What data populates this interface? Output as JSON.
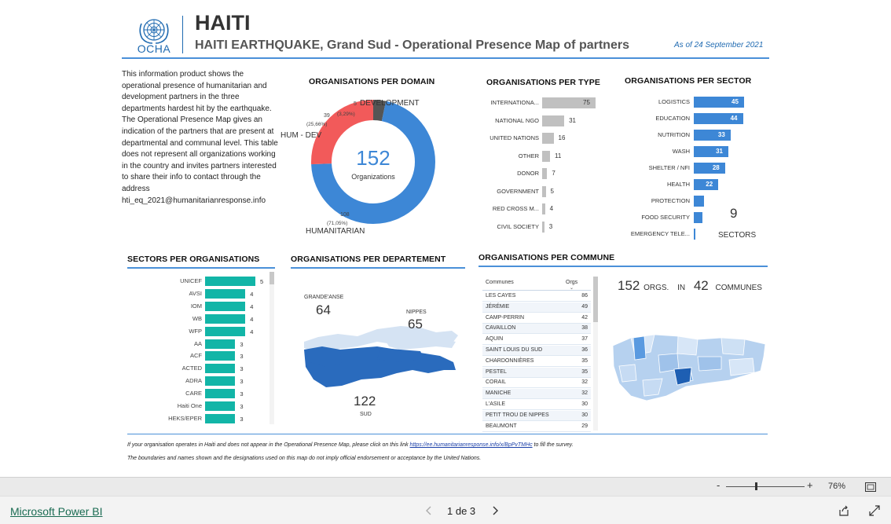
{
  "header": {
    "org_name": "OCHA",
    "title": "HAITI",
    "subtitle": "HAITI EARTHQUAKE, Grand Sud - Operational Presence Map of partners",
    "as_of": "As of 24 September 2021"
  },
  "description": "This information product shows the operational presence of humanitarian and development partners in the three departments hardest hit by the earthquake. The Operational Presence Map gives an indication of the partners that are present at departmental and communal level. This table does not represent all organizations working in the country and invites partners interested to share their info to contact through the address hti_eq_2021@humanitarianresponse.info",
  "domain_section": {
    "title": "ORGANISATIONS PER DOMAIN",
    "total": "152",
    "total_label": "Organizations",
    "slices": [
      {
        "name": "HUMANITARIAN",
        "count": "108",
        "pct": "(71,05%)",
        "value": 108,
        "color": "#3d87d6"
      },
      {
        "name": "HUM - DEV",
        "count": "39",
        "pct": "(25,66%)",
        "value": 39,
        "color": "#f25a5a"
      },
      {
        "name": "DEVELOPMENT",
        "count": "5",
        "pct": "(3,29%)",
        "value": 5,
        "color": "#555555"
      }
    ]
  },
  "type_section": {
    "title": "ORGANISATIONS PER TYPE",
    "items": [
      {
        "label": "INTERNATIONA...",
        "value": 75
      },
      {
        "label": "NATIONAL NGO",
        "value": 31
      },
      {
        "label": "UNITED NATIONS",
        "value": 16
      },
      {
        "label": "OTHER",
        "value": 11
      },
      {
        "label": "DONOR",
        "value": 7
      },
      {
        "label": "GOVERNMENT",
        "value": 5
      },
      {
        "label": "RED CROSS M...",
        "value": 4
      },
      {
        "label": "CIVIL SOCIETY",
        "value": 3
      }
    ]
  },
  "sector_section": {
    "title": "ORGANISATIONS PER SECTOR",
    "items": [
      {
        "label": "LOGISTICS",
        "value": 45
      },
      {
        "label": "EDUCATION",
        "value": 44
      },
      {
        "label": "NUTRITION",
        "value": 33
      },
      {
        "label": "WASH",
        "value": 31
      },
      {
        "label": "SHELTER / NFI",
        "value": 28
      },
      {
        "label": "HEALTH",
        "value": 22
      },
      {
        "label": "PROTECTION",
        "value": 9
      },
      {
        "label": "FOOD SECURITY",
        "value": 8
      },
      {
        "label": "EMERGENCY TELE...",
        "value": 1
      }
    ],
    "count": "9",
    "count_label": "SECTORS"
  },
  "orgs_section": {
    "title": "SECTORS PER ORGANISATIONS",
    "items": [
      {
        "label": "UNICEF",
        "value": 5
      },
      {
        "label": "AVSI",
        "value": 4
      },
      {
        "label": "IOM",
        "value": 4
      },
      {
        "label": "WB",
        "value": 4
      },
      {
        "label": "WFP",
        "value": 4
      },
      {
        "label": "AA",
        "value": 3
      },
      {
        "label": "ACF",
        "value": 3
      },
      {
        "label": "ACTED",
        "value": 3
      },
      {
        "label": "ADRA",
        "value": 3
      },
      {
        "label": "CARE",
        "value": 3
      },
      {
        "label": "Haiti One",
        "value": 3
      },
      {
        "label": "HEKS/EPER",
        "value": 3
      }
    ]
  },
  "dept_section": {
    "title": "ORGANISATIONS PER DEPARTEMENT",
    "grande_anse_label": "GRANDE'ANSE",
    "grande_anse_value": "64",
    "nippes_label": "NIPPES",
    "nippes_value": "65",
    "sud_value": "122",
    "sud_label": "SUD"
  },
  "commune_section": {
    "title": "ORGANISATIONS PER COMMUNE",
    "col_name": "Communes",
    "col_orgs": "Orgs",
    "sort_icon": "chevron-down",
    "rows": [
      {
        "name": "LES CAYES",
        "value": "86"
      },
      {
        "name": "JÉRÉMIE",
        "value": "49"
      },
      {
        "name": "CAMP-PERRIN",
        "value": "42"
      },
      {
        "name": "CAVAILLON",
        "value": "38"
      },
      {
        "name": "AQUIN",
        "value": "37"
      },
      {
        "name": "SAINT LOUIS DU SUD",
        "value": "36"
      },
      {
        "name": "CHARDONNIÈRES",
        "value": "35"
      },
      {
        "name": "PESTEL",
        "value": "35"
      },
      {
        "name": "CORAIL",
        "value": "32"
      },
      {
        "name": "MANICHE",
        "value": "32"
      },
      {
        "name": "L'ASILE",
        "value": "30"
      },
      {
        "name": "PETIT TROU DE NIPPES",
        "value": "30"
      },
      {
        "name": "BEAUMONT",
        "value": "29"
      }
    ],
    "orgs_total": "152",
    "orgs_word": "ORGS.",
    "in_word": "IN",
    "communes_total": "42",
    "communes_word": "COMMUNES"
  },
  "footnotes": {
    "line1_before": "If your organisation operates in Haiti and does not appear in the Operational Presence Map, please click on this link ",
    "line1_link": "https://ee.humanitarianresponse.info/x/BpPvTMHc",
    "line1_after": " to fill the survey.",
    "line2": "The boundaries and names shown and the designations used on this map do not imply official endorsement or acceptance by the United Nations."
  },
  "zoom_bar": {
    "minus": "-",
    "plus": "+",
    "zoom_level": "76%",
    "zoom_fraction": 0.37,
    "fit_icon": "fit-to-page-icon"
  },
  "status_bar": {
    "brand": "Microsoft Power BI",
    "page_indicator": "1 de 3",
    "prev_icon": "chevron-left-icon",
    "next_icon": "chevron-right-icon",
    "share_icon": "share-icon",
    "expand_icon": "fullscreen-icon"
  },
  "colors": {
    "accent_blue": "#3d87d6",
    "teal": "#12b5a7",
    "red": "#f25a5a",
    "gray_bar": "#c0c0c0",
    "un_blue": "#1f6ab1"
  }
}
